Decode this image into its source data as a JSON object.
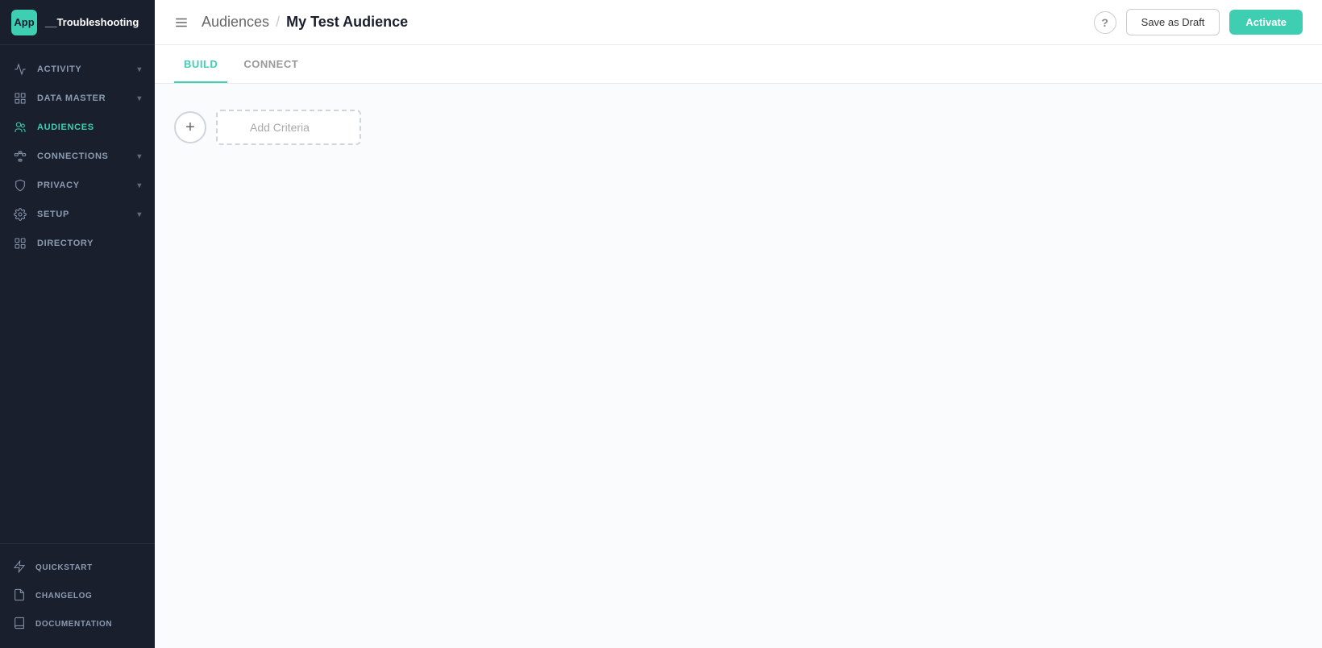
{
  "app": {
    "logo_text": "App",
    "name": "__Troubleshooting"
  },
  "sidebar": {
    "items": [
      {
        "id": "activity",
        "label": "ACTIVITY",
        "icon": "activity-icon",
        "has_chevron": true,
        "active": false
      },
      {
        "id": "data-master",
        "label": "DATA MASTER",
        "icon": "data-master-icon",
        "has_chevron": true,
        "active": false
      },
      {
        "id": "audiences",
        "label": "AUDIENCES",
        "icon": "audiences-icon",
        "has_chevron": false,
        "active": true
      },
      {
        "id": "connections",
        "label": "CONNECTIONS",
        "icon": "connections-icon",
        "has_chevron": true,
        "active": false
      },
      {
        "id": "privacy",
        "label": "PRIVACY",
        "icon": "privacy-icon",
        "has_chevron": true,
        "active": false
      },
      {
        "id": "setup",
        "label": "SETUP",
        "icon": "setup-icon",
        "has_chevron": true,
        "active": false
      },
      {
        "id": "directory",
        "label": "DIRECTORY",
        "icon": "directory-icon",
        "has_chevron": false,
        "active": false
      }
    ],
    "bottom_items": [
      {
        "id": "quickstart",
        "label": "QUICKSTART",
        "icon": "quickstart-icon"
      },
      {
        "id": "changelog",
        "label": "CHANGELOG",
        "icon": "changelog-icon"
      },
      {
        "id": "documentation",
        "label": "DOCUMENTATION",
        "icon": "documentation-icon"
      }
    ]
  },
  "header": {
    "breadcrumb_parent": "Audiences",
    "breadcrumb_sep": "/",
    "breadcrumb_current": "My Test Audience",
    "save_draft_label": "Save as Draft",
    "activate_label": "Activate"
  },
  "tabs": [
    {
      "id": "build",
      "label": "BUILD",
      "active": true
    },
    {
      "id": "connect",
      "label": "CONNECT",
      "active": false
    }
  ],
  "build": {
    "add_criteria_label": "Add Criteria",
    "plus_symbol": "+"
  }
}
